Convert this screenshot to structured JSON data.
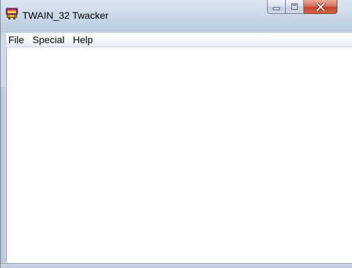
{
  "window": {
    "title": "TWAIN_32 Twacker",
    "icon": "twacker-app-icon",
    "controls": {
      "minimize": "minimize-icon",
      "maximize": "maximize-icon",
      "close": "close-icon"
    }
  },
  "menubar": {
    "items": [
      {
        "label": "File"
      },
      {
        "label": "Special"
      },
      {
        "label": "Help"
      }
    ]
  },
  "colors": {
    "title_bar": "#cfdcea",
    "close_button": "#c9452a",
    "client_background": "#ffffff"
  }
}
